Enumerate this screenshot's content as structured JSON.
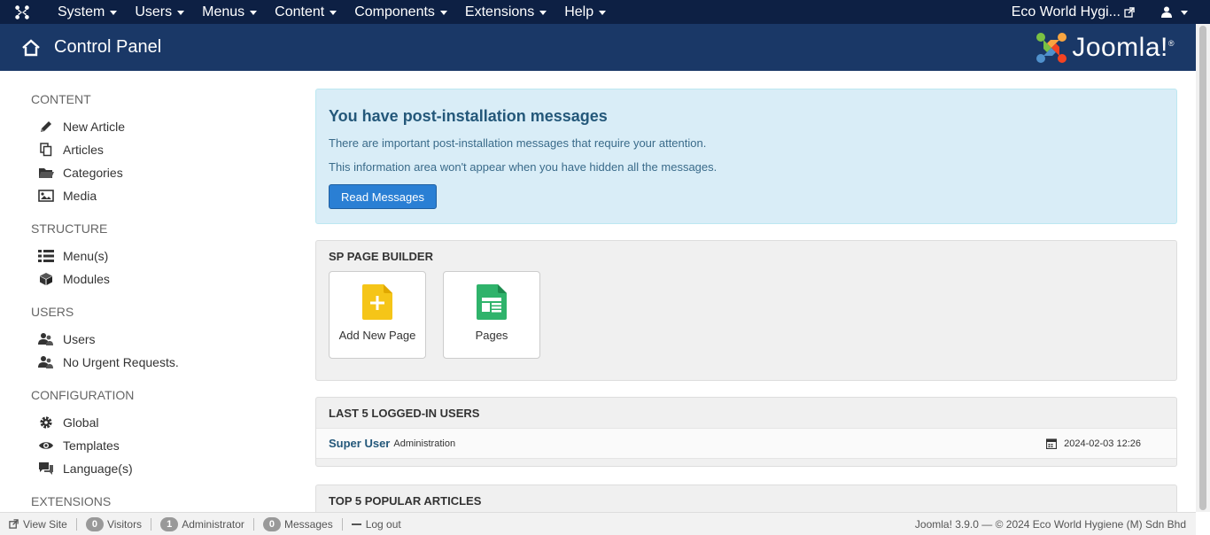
{
  "navbar": {
    "menu": [
      {
        "label": "System"
      },
      {
        "label": "Users"
      },
      {
        "label": "Menus"
      },
      {
        "label": "Content"
      },
      {
        "label": "Components"
      },
      {
        "label": "Extensions"
      },
      {
        "label": "Help"
      }
    ],
    "site_name": "Eco World Hygi..."
  },
  "header": {
    "title": "Control Panel",
    "logo_text": "Joomla!",
    "logo_reg": "®"
  },
  "sidebar": {
    "groups": [
      {
        "heading": "CONTENT",
        "items": [
          {
            "label": "New Article",
            "icon": "pencil-icon"
          },
          {
            "label": "Articles",
            "icon": "copy-icon"
          },
          {
            "label": "Categories",
            "icon": "folder-icon"
          },
          {
            "label": "Media",
            "icon": "image-icon"
          }
        ]
      },
      {
        "heading": "STRUCTURE",
        "items": [
          {
            "label": "Menu(s)",
            "icon": "list-icon"
          },
          {
            "label": "Modules",
            "icon": "cube-icon"
          }
        ]
      },
      {
        "heading": "USERS",
        "items": [
          {
            "label": "Users",
            "icon": "users-icon"
          },
          {
            "label": "No Urgent Requests.",
            "icon": "users-icon"
          }
        ]
      },
      {
        "heading": "CONFIGURATION",
        "items": [
          {
            "label": "Global",
            "icon": "cog-icon"
          },
          {
            "label": "Templates",
            "icon": "eye-icon"
          },
          {
            "label": "Language(s)",
            "icon": "comments-icon"
          }
        ]
      },
      {
        "heading": "EXTENSIONS",
        "items": []
      }
    ]
  },
  "alert": {
    "title": "You have post-installation messages",
    "line1": "There are important post-installation messages that require your attention.",
    "line2": "This information area won't appear when you have hidden all the messages.",
    "button": "Read Messages"
  },
  "sp_page_builder": {
    "title": "SP PAGE BUILDER",
    "tiles": [
      {
        "label": "Add New Page",
        "icon": "add-page-icon",
        "color": "#f5c518"
      },
      {
        "label": "Pages",
        "icon": "pages-icon",
        "color": "#2fb36b"
      }
    ]
  },
  "logged_users": {
    "title": "LAST 5 LOGGED-IN USERS",
    "rows": [
      {
        "name": "Super User",
        "role": "Administration",
        "date": "2024-02-03 12:26"
      }
    ]
  },
  "popular": {
    "title": "TOP 5 POPULAR ARTICLES"
  },
  "statusbar": {
    "view_site": "View Site",
    "visitors_count": "0",
    "visitors_label": "Visitors",
    "admin_count": "1",
    "admin_label": "Administrator",
    "messages_count": "0",
    "messages_label": "Messages",
    "logout": "Log out",
    "copyright": "Joomla! 3.9.0 — © 2024 Eco World Hygiene (M) Sdn Bhd"
  },
  "colors": {
    "navbar": "#0d2044",
    "header": "#1a3867",
    "alert_bg": "#d9edf7",
    "primary": "#2a7fd4"
  }
}
